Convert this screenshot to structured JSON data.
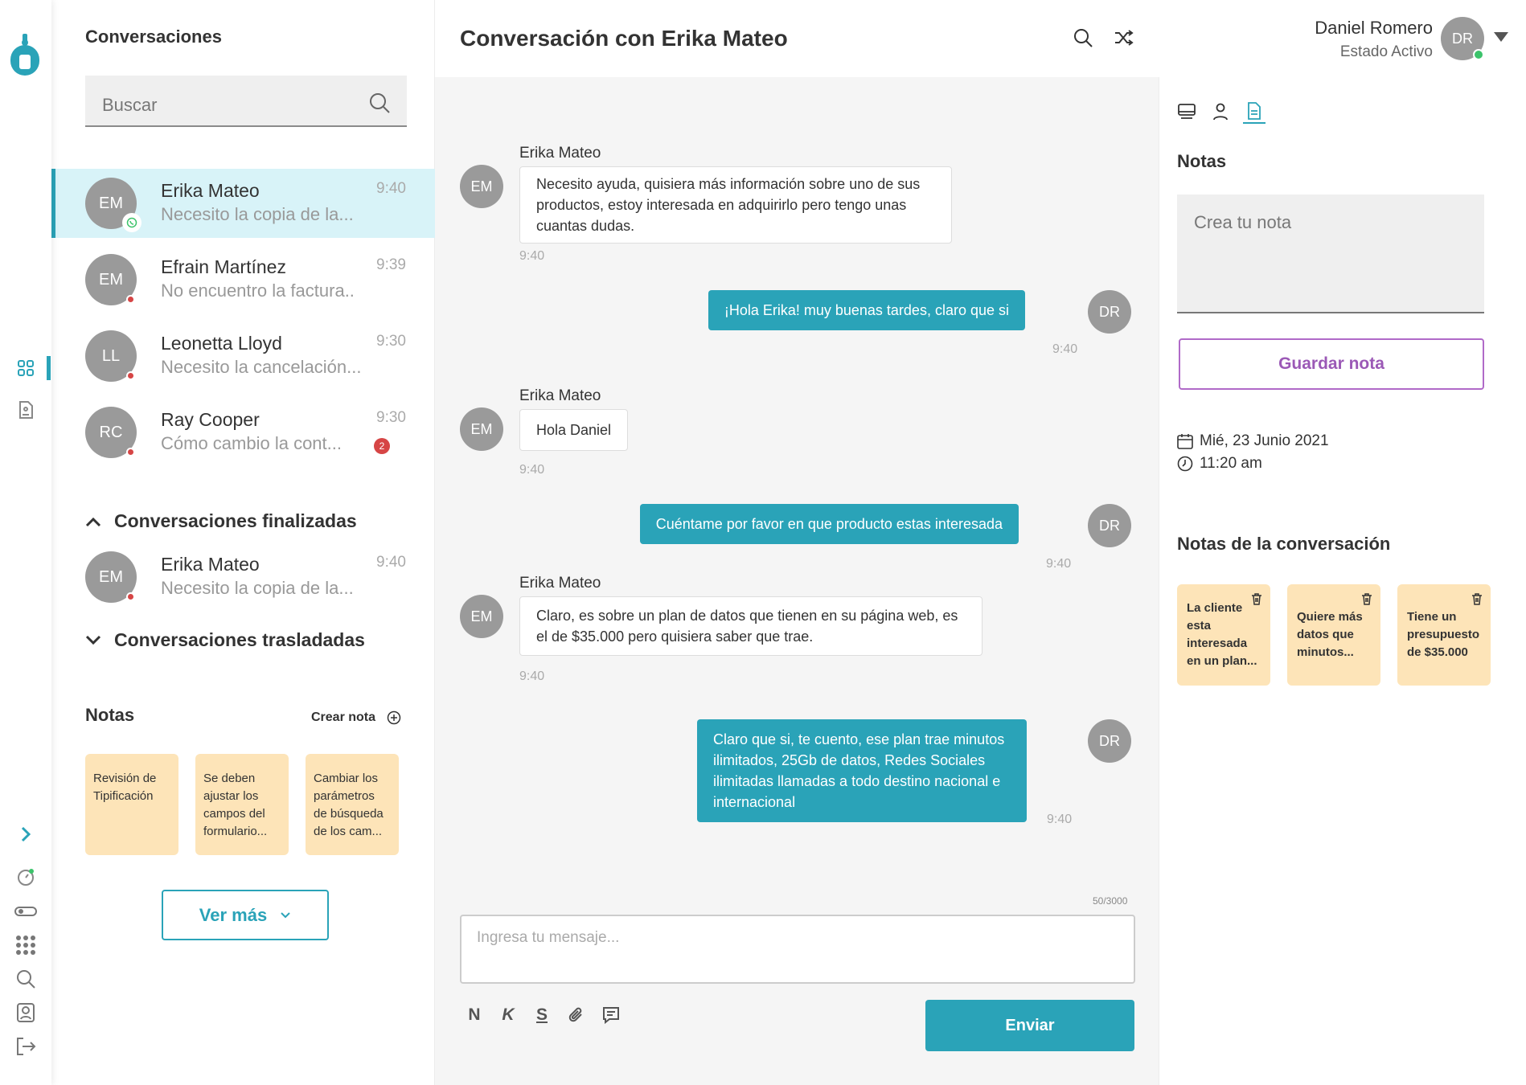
{
  "sidebar": {
    "title": "Conversaciones",
    "search": {
      "placeholder": "Buscar"
    },
    "conversations": [
      {
        "initials": "EM",
        "name": "Erika Mateo",
        "preview": "Necesito la copia de la...",
        "time": "9:40",
        "channel": "whatsapp-icon"
      },
      {
        "initials": "EM",
        "name": "Efrain Martínez",
        "preview": "No encuentro la factura..",
        "time": "9:39"
      },
      {
        "initials": "LL",
        "name": "Leonetta Lloyd",
        "preview": "Necesito la cancelación...",
        "time": "9:30"
      },
      {
        "initials": "RC",
        "name": "Ray Cooper",
        "preview": "Cómo cambio la cont...",
        "time": "9:30",
        "badge": "2"
      }
    ],
    "finished": {
      "label": "Conversaciones finalizadas",
      "items": [
        {
          "initials": "EM",
          "name": "Erika Mateo",
          "preview": "Necesito la copia de la...",
          "time": "9:40"
        }
      ]
    },
    "transferred": {
      "label": "Conversaciones trasladadas"
    },
    "notes": {
      "title": "Notas",
      "create_label": "Crear nota",
      "items": [
        "Revisión de Tipificación",
        "Se deben ajustar los campos del formulario...",
        "Cambiar los parámetros de búsqueda de los cam..."
      ]
    },
    "more_label": "Ver más"
  },
  "chat": {
    "title": "Conversación con Erika Mateo",
    "messages": [
      {
        "from": "EM",
        "name": "Erika Mateo",
        "text": "Necesito ayuda, quisiera más información sobre uno de sus productos, estoy interesada en adquirirlo pero tengo unas cuantas dudas.",
        "time": "9:40"
      },
      {
        "from": "DR",
        "text": "¡Hola Erika! muy buenas tardes, claro que si",
        "time": "9:40"
      },
      {
        "from": "EM",
        "name": "Erika Mateo",
        "text": "Hola Daniel",
        "time": "9:40"
      },
      {
        "from": "DR",
        "text": "Cuéntame por favor en que producto estas interesada",
        "time": "9:40"
      },
      {
        "from": "EM",
        "name": "Erika Mateo",
        "text": "Claro, es sobre un plan de datos que tienen en su página web, es el de $35.000 pero quisiera saber que trae.",
        "time": "9:40"
      },
      {
        "from": "DR",
        "text": "Claro que si, te cuento, ese plan trae minutos ilimitados, 25Gb de datos, Redes Sociales ilimitadas llamadas a todo destino nacional e internacional",
        "time": "9:40"
      }
    ],
    "counter": "50/3000",
    "composer_placeholder": "Ingresa tu mensaje...",
    "format": {
      "bold": "N",
      "italic": "K",
      "strike": "S"
    },
    "send_label": "Enviar"
  },
  "user": {
    "name": "Daniel Romero",
    "status": "Estado Activo",
    "initials": "DR"
  },
  "right_panel": {
    "notes_title": "Notas",
    "note_placeholder": "Crea tu nota",
    "save_label": "Guardar nota",
    "date": "Mié, 23 Junio 2021",
    "time": "11:20 am",
    "conv_notes_title": "Notas de la conversación",
    "conv_notes": [
      "La cliente esta interesada en un plan...",
      "Quiere más datos que minutos...",
      "Tiene un presupuesto de $35.000"
    ]
  },
  "colors": {
    "accent": "#2aa3b8",
    "note_bg": "#fde4b8",
    "purple": "#9b59b6",
    "alert": "#d64545",
    "online": "#3cc36b"
  }
}
